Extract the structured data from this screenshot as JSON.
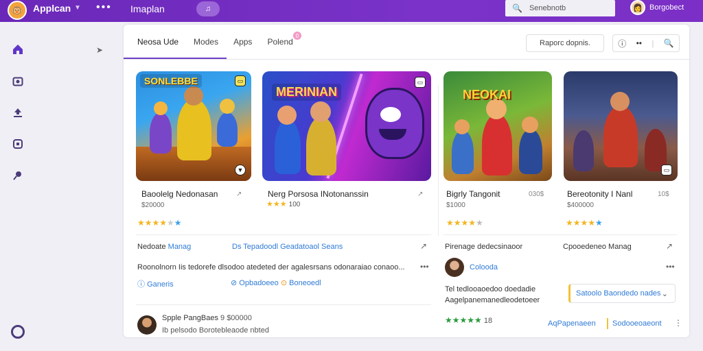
{
  "topbar": {
    "app_name": "Applcan",
    "menu_dots": "•••",
    "title": "Imaplan",
    "pill_icon": "music-note-icon",
    "search_placeholder": "Senebnotb",
    "user_name": "Borgobect"
  },
  "sidebar": {
    "items": [
      {
        "icon": "home-icon"
      },
      {
        "icon": "camera-icon"
      },
      {
        "icon": "upload-icon"
      },
      {
        "icon": "library-icon"
      },
      {
        "icon": "pin-icon"
      }
    ],
    "bottom_icon": "settings-circle-icon"
  },
  "tabs": [
    {
      "label": "Neosa Ude",
      "active": true
    },
    {
      "label": "Modes"
    },
    {
      "label": "Apps"
    },
    {
      "label": "Polend",
      "badge": "0"
    }
  ],
  "card_search_placeholder": "Raporc dopnis.",
  "games": [
    {
      "title": "Baoolelg Nedonasan",
      "subtitle": "$20000",
      "art_text": "SONLEBBE",
      "rating": 4
    },
    {
      "title": "Nerg Porsosa INotonanssin",
      "subtitle": "",
      "rating_label": "100",
      "art_text": "MERINIAN",
      "rating": 3
    },
    {
      "title": "Bigrly Tangonit",
      "subtitle": "$1000",
      "share": "030$",
      "art_text": "NEOKAI",
      "rating": 4
    },
    {
      "title": "Bereotonity I Nanl",
      "subtitle": "$400000",
      "share": "10$",
      "art_text": "",
      "rating": 4
    }
  ],
  "feed": {
    "row1_label": "Nedoate",
    "row1_link1": "Manag",
    "row1_link2": "Ds Tepadoodl Geadatoaol Seans",
    "row2_text": "Roonolnorn Iis tedorefe dlsodoo atedeted der agalesrsans odonaraiao conaoo...",
    "link_a": "Ganeris",
    "link_b": "Opbadoeeo",
    "link_c": "Boneoedl",
    "right_row1_left": "Pirenage dedecsinaoor",
    "right_row1_right": "Cpooedeneo Manag",
    "commenter_name": "Colooda",
    "right_text1": "Tel tedlooaoedoo doedadie",
    "right_text2": "Aagelpanemanedleodetoeer",
    "dropdown_value": "Satoolo Baondedo nades",
    "reviewer_name": "Spple PangBaes",
    "reviewer_meta": "9 $00000",
    "reviewer_text": "Ib pelsodo Borotebleaode nbted",
    "green_rating_count": "18",
    "bottom_link1": "AqPapenaeen",
    "bottom_link2": "Sodooeoaeont"
  },
  "colors": {
    "topbar": "#6a28b8",
    "accent": "#6b3fc4",
    "link": "#2f7bd6",
    "star": "#f3b520",
    "star_green": "#2a9a3c"
  }
}
